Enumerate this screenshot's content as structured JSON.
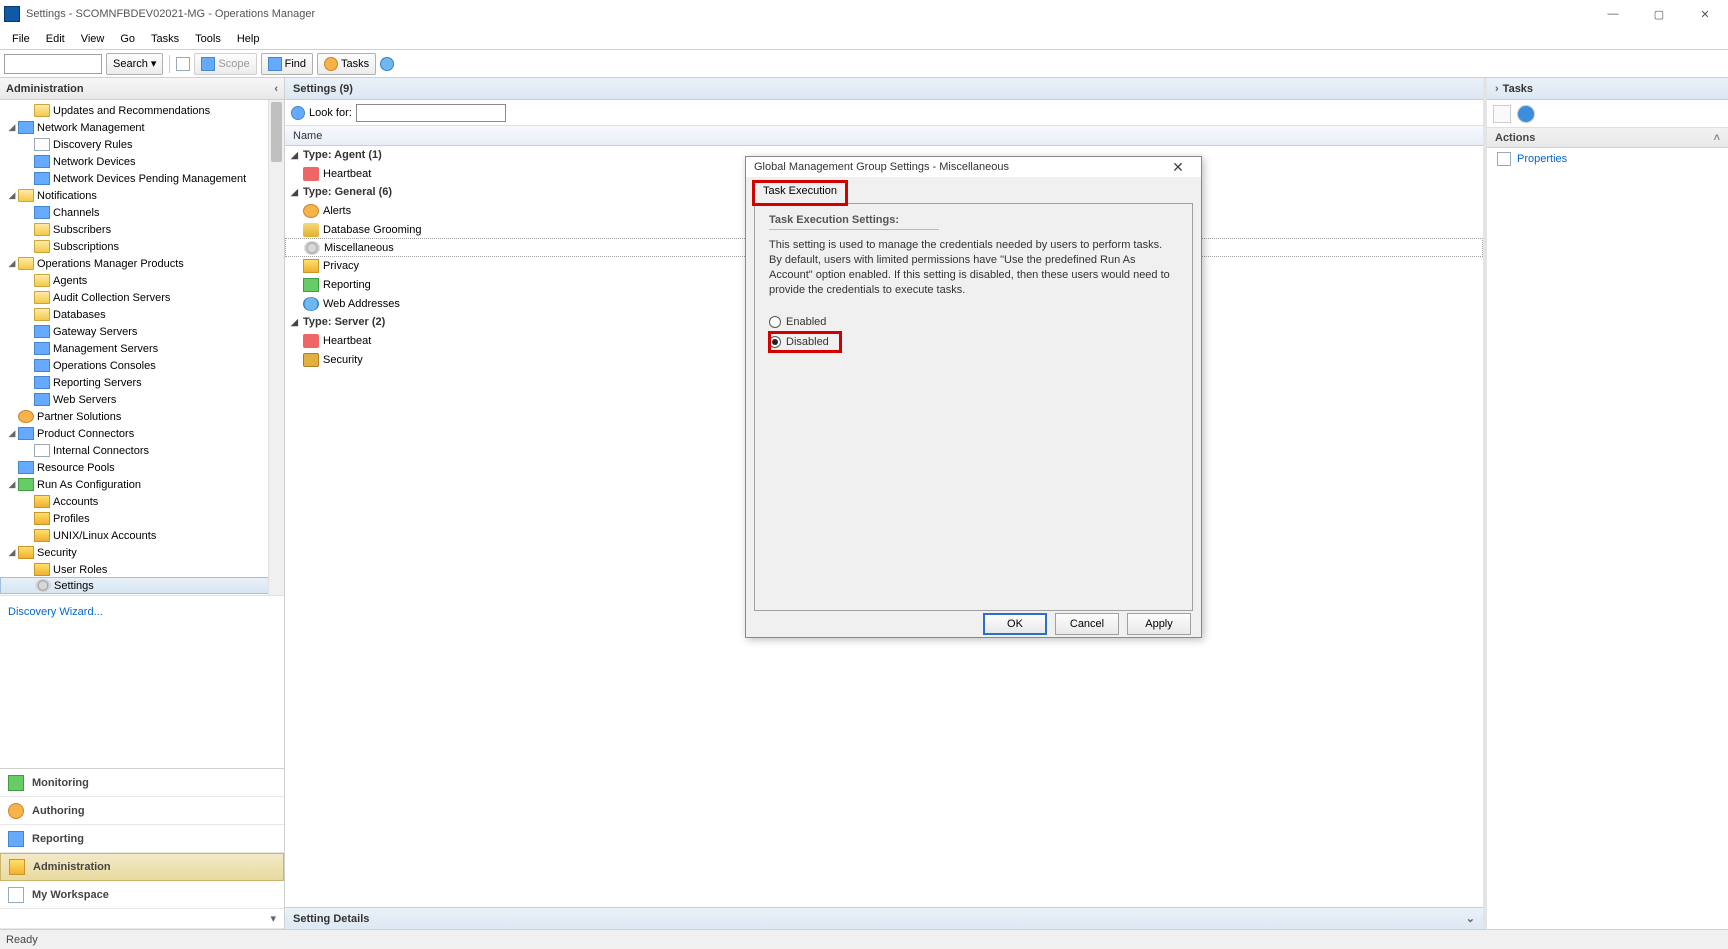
{
  "window": {
    "title": "Settings - SCOMNFBDEV02021-MG - Operations Manager"
  },
  "menubar": [
    "File",
    "Edit",
    "View",
    "Go",
    "Tasks",
    "Tools",
    "Help"
  ],
  "toolbar": {
    "search_label": "Search",
    "scope_label": "Scope",
    "find_label": "Find",
    "tasks_label": "Tasks"
  },
  "admin_panel": {
    "title": "Administration",
    "wizard_link": "Discovery Wizard...",
    "tree": [
      {
        "indent": 1,
        "exp": "",
        "icon": "ic-folder",
        "label": "Updates and Recommendations"
      },
      {
        "indent": 0,
        "exp": "▾",
        "icon": "ic-blue",
        "label": "Network Management"
      },
      {
        "indent": 1,
        "exp": "",
        "icon": "ic-doc",
        "label": "Discovery Rules"
      },
      {
        "indent": 1,
        "exp": "",
        "icon": "ic-blue",
        "label": "Network Devices"
      },
      {
        "indent": 1,
        "exp": "",
        "icon": "ic-blue",
        "label": "Network Devices Pending Management"
      },
      {
        "indent": 0,
        "exp": "▾",
        "icon": "ic-folder",
        "label": "Notifications"
      },
      {
        "indent": 1,
        "exp": "",
        "icon": "ic-blue",
        "label": "Channels"
      },
      {
        "indent": 1,
        "exp": "",
        "icon": "ic-folder",
        "label": "Subscribers"
      },
      {
        "indent": 1,
        "exp": "",
        "icon": "ic-folder",
        "label": "Subscriptions"
      },
      {
        "indent": 0,
        "exp": "▾",
        "icon": "ic-folder",
        "label": "Operations Manager Products"
      },
      {
        "indent": 1,
        "exp": "",
        "icon": "ic-folder",
        "label": "Agents"
      },
      {
        "indent": 1,
        "exp": "",
        "icon": "ic-folder",
        "label": "Audit Collection Servers"
      },
      {
        "indent": 1,
        "exp": "",
        "icon": "ic-folder",
        "label": "Databases"
      },
      {
        "indent": 1,
        "exp": "",
        "icon": "ic-blue",
        "label": "Gateway Servers"
      },
      {
        "indent": 1,
        "exp": "",
        "icon": "ic-blue",
        "label": "Management Servers"
      },
      {
        "indent": 1,
        "exp": "",
        "icon": "ic-blue",
        "label": "Operations Consoles"
      },
      {
        "indent": 1,
        "exp": "",
        "icon": "ic-blue",
        "label": "Reporting Servers"
      },
      {
        "indent": 1,
        "exp": "",
        "icon": "ic-blue",
        "label": "Web Servers"
      },
      {
        "indent": 0,
        "exp": "",
        "icon": "ic-orange",
        "label": "Partner Solutions"
      },
      {
        "indent": 0,
        "exp": "▾",
        "icon": "ic-blue",
        "label": "Product Connectors"
      },
      {
        "indent": 1,
        "exp": "",
        "icon": "ic-doc",
        "label": "Internal Connectors"
      },
      {
        "indent": 0,
        "exp": "",
        "icon": "ic-blue",
        "label": "Resource Pools"
      },
      {
        "indent": 0,
        "exp": "▾",
        "icon": "ic-green",
        "label": "Run As Configuration"
      },
      {
        "indent": 1,
        "exp": "",
        "icon": "ic-shield",
        "label": "Accounts"
      },
      {
        "indent": 1,
        "exp": "",
        "icon": "ic-shield",
        "label": "Profiles"
      },
      {
        "indent": 1,
        "exp": "",
        "icon": "ic-shield",
        "label": "UNIX/Linux Accounts"
      },
      {
        "indent": 0,
        "exp": "▾",
        "icon": "ic-shield",
        "label": "Security"
      },
      {
        "indent": 1,
        "exp": "",
        "icon": "ic-shield",
        "label": "User Roles"
      },
      {
        "indent": 1,
        "exp": "",
        "icon": "ic-gear",
        "label": "Settings",
        "selected": true
      }
    ]
  },
  "wunderbar": [
    {
      "icon": "ic-green",
      "label": "Monitoring"
    },
    {
      "icon": "ic-orange",
      "label": "Authoring"
    },
    {
      "icon": "ic-blue",
      "label": "Reporting"
    },
    {
      "icon": "ic-shield",
      "label": "Administration",
      "active": true
    },
    {
      "icon": "ic-doc",
      "label": "My Workspace"
    }
  ],
  "center": {
    "title": "Settings (9)",
    "lookfor_label": "Look for:",
    "column_header": "Name",
    "groups": [
      {
        "header": "Type: Agent (1)",
        "items": [
          {
            "icon": "ic-heart",
            "label": "Heartbeat"
          }
        ]
      },
      {
        "header": "Type: General (6)",
        "items": [
          {
            "icon": "ic-orange",
            "label": "Alerts"
          },
          {
            "icon": "ic-db",
            "label": "Database Grooming"
          },
          {
            "icon": "ic-gear",
            "label": "Miscellaneous",
            "selected": true
          },
          {
            "icon": "ic-shield",
            "label": "Privacy"
          },
          {
            "icon": "ic-green",
            "label": "Reporting"
          },
          {
            "icon": "ic-globe",
            "label": "Web Addresses"
          }
        ]
      },
      {
        "header": "Type: Server (2)",
        "items": [
          {
            "icon": "ic-heart",
            "label": "Heartbeat"
          },
          {
            "icon": "ic-lock",
            "label": "Security"
          }
        ]
      }
    ],
    "details_header": "Setting Details"
  },
  "tasks_panel": {
    "title": "Tasks",
    "actions_header": "Actions",
    "actions": [
      {
        "icon": "ic-doc",
        "label": "Properties"
      }
    ]
  },
  "dialog": {
    "title": "Global Management Group Settings - Miscellaneous",
    "tab": "Task Execution",
    "section_title": "Task Execution Settings:",
    "description": "This setting is used to manage the credentials needed by users to perform tasks. By default, users with limited permissions have \"Use the predefined Run As Account\" option enabled. If this setting is disabled, then these users would need to provide the credentials to execute tasks.",
    "opt_enabled": "Enabled",
    "opt_disabled": "Disabled",
    "btn_ok": "OK",
    "btn_cancel": "Cancel",
    "btn_apply": "Apply"
  },
  "statusbar": {
    "text": "Ready"
  }
}
